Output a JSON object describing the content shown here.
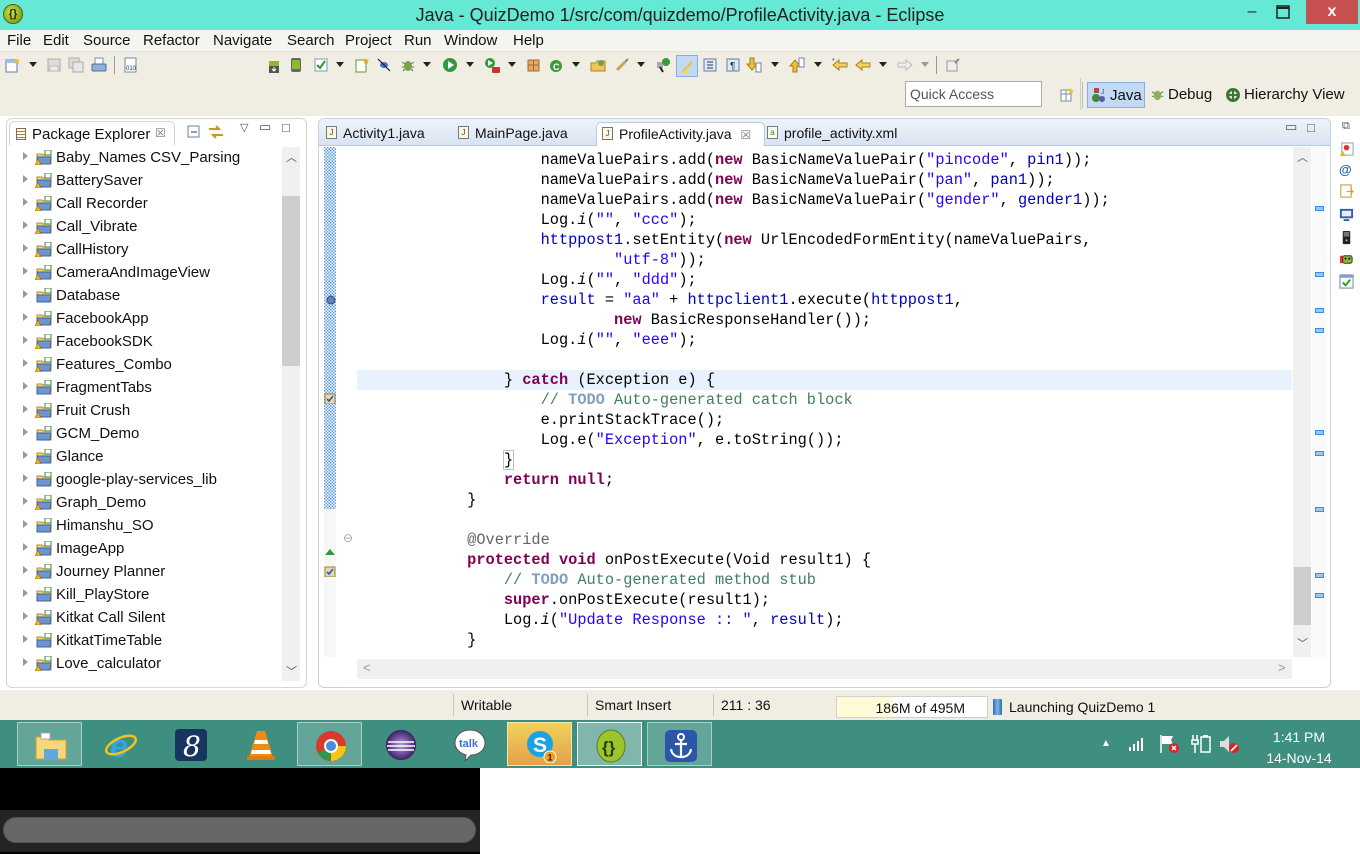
{
  "window": {
    "title": "Java - QuizDemo 1/src/com/quizdemo/ProfileActivity.java - Eclipse",
    "minimize": "–",
    "maximize": "❐",
    "close": "x"
  },
  "menu": [
    "File",
    "Edit",
    "Source",
    "Refactor",
    "Navigate",
    "Search",
    "Project",
    "Run",
    "Window",
    "Help"
  ],
  "toolbar": {
    "quick_access_placeholder": "Quick Access",
    "perspectives": [
      {
        "label": "Java",
        "icon": "java-perspective-icon",
        "active": true
      },
      {
        "label": "Debug",
        "icon": "debug-perspective-icon",
        "active": false
      },
      {
        "label": "Hierarchy View",
        "icon": "hierarchy-view-icon",
        "active": false
      }
    ]
  },
  "package_explorer": {
    "title": "Package Explorer",
    "close": "☒",
    "projects": [
      {
        "name": "Baby_Names CSV_Parsing",
        "warning": true
      },
      {
        "name": "BatterySaver",
        "warning": true
      },
      {
        "name": "Call Recorder",
        "warning": true
      },
      {
        "name": "Call_Vibrate",
        "warning": true
      },
      {
        "name": "CallHistory",
        "warning": true
      },
      {
        "name": "CameraAndImageView",
        "warning": true
      },
      {
        "name": "Database",
        "warning": false
      },
      {
        "name": "FacebookApp",
        "warning": true
      },
      {
        "name": "FacebookSDK",
        "warning": true
      },
      {
        "name": "Features_Combo",
        "warning": true
      },
      {
        "name": "FragmentTabs",
        "warning": false
      },
      {
        "name": "Fruit Crush",
        "warning": true
      },
      {
        "name": "GCM_Demo",
        "warning": false
      },
      {
        "name": "Glance",
        "warning": true
      },
      {
        "name": "google-play-services_lib",
        "warning": false
      },
      {
        "name": "Graph_Demo",
        "warning": true
      },
      {
        "name": "Himanshu_SO",
        "warning": false
      },
      {
        "name": "ImageApp",
        "warning": true
      },
      {
        "name": "Journey Planner",
        "warning": true
      },
      {
        "name": "Kill_PlayStore",
        "warning": false
      },
      {
        "name": "Kitkat Call Silent",
        "warning": true
      },
      {
        "name": "KitkatTimeTable",
        "warning": false
      },
      {
        "name": "Love_calculator",
        "warning": true
      }
    ]
  },
  "editor": {
    "tabs": [
      {
        "label": "Activity1.java",
        "type": "java",
        "active": false
      },
      {
        "label": "MainPage.java",
        "type": "java",
        "active": false
      },
      {
        "label": "ProfileActivity.java",
        "type": "java",
        "active": true
      },
      {
        "label": "profile_activity.xml",
        "type": "xml",
        "active": false
      }
    ],
    "tab_close": "☒",
    "code_lines": [
      "                    nameValuePairs.add(new BasicNameValuePair(\"pincode\", pin1));",
      "                    nameValuePairs.add(new BasicNameValuePair(\"pan\", pan1));",
      "                    nameValuePairs.add(new BasicNameValuePair(\"gender\", gender1));",
      "                    Log.i(\"\", \"ccc\");",
      "                    httppost1.setEntity(new UrlEncodedFormEntity(nameValuePairs,",
      "                            \"utf-8\"));",
      "                    Log.i(\"\", \"ddd\");",
      "                    result = \"aa\" + httpclient1.execute(httppost1,",
      "                            new BasicResponseHandler());",
      "                    Log.i(\"\", \"eee\");",
      "",
      "                } catch (Exception e) {",
      "                    // TODO Auto-generated catch block",
      "                    e.printStackTrace();",
      "                    Log.e(\"Exception\", e.toString());",
      "                }",
      "                return null;",
      "            }",
      "",
      "            @Override",
      "            protected void onPostExecute(Void result1) {",
      "                // TODO Auto-generated method stub",
      "                super.onPostExecute(result1);",
      "                Log.i(\"Update Response :: \", result);",
      "            }"
    ],
    "current_line_index": 11
  },
  "statusbar": {
    "writable": "Writable",
    "insert_mode": "Smart Insert",
    "cursor_position": "211 : 36",
    "heap": "186M of 495M",
    "heap_used_mb": 186,
    "heap_total_mb": 495,
    "progress": "Launching QuizDemo 1"
  },
  "taskbar": {
    "apps": [
      {
        "name": "File Explorer",
        "icon": "file-explorer-icon"
      },
      {
        "name": "Internet Explorer",
        "icon": "internet-explorer-icon"
      },
      {
        "name": "8",
        "icon": "app-8-icon"
      },
      {
        "name": "VLC",
        "icon": "vlc-icon"
      },
      {
        "name": "Chrome",
        "icon": "chrome-icon"
      },
      {
        "name": "Eclipse",
        "icon": "eclipse-icon"
      },
      {
        "name": "Google Talk",
        "icon": "gtalk-icon",
        "text": "talk"
      },
      {
        "name": "Skype",
        "icon": "skype-icon",
        "badge": "1"
      },
      {
        "name": "Eclipse ADT",
        "icon": "adt-icon"
      },
      {
        "name": "Anchor",
        "icon": "anchor-icon"
      }
    ],
    "clock_time": "1:41 PM",
    "clock_date": "14-Nov-14"
  }
}
